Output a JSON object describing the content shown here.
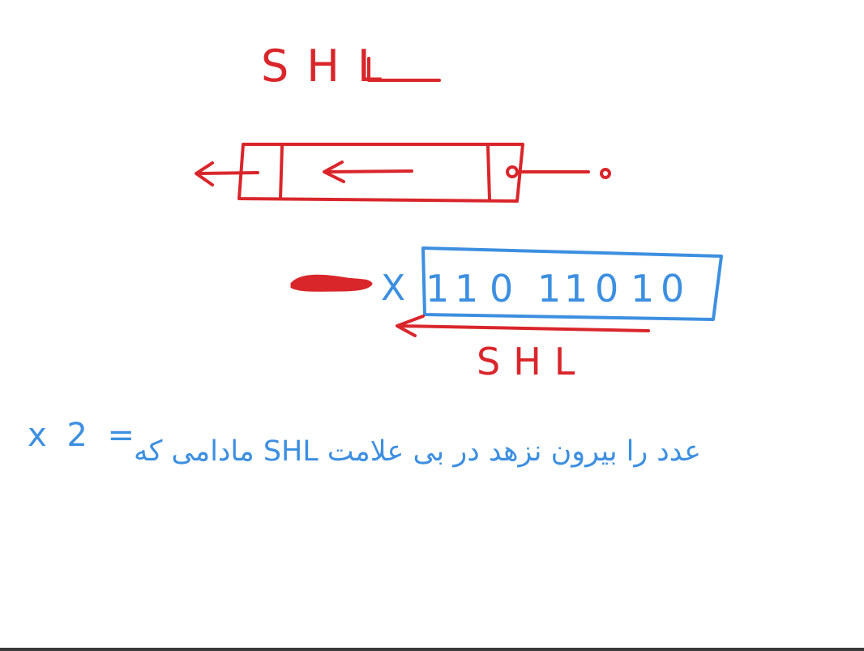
{
  "title": "SHL",
  "register": {
    "bits": [
      "1",
      "1",
      "0",
      "1",
      "1",
      "0",
      "1",
      "0"
    ],
    "discarded_marker": "X",
    "operation_label": "SHL"
  },
  "note": {
    "expression": "x 2 =",
    "persian_text": "مادامی که SHL عدد را بیرون نزهد در بی علامت"
  },
  "colors": {
    "red": "#d9262b",
    "blue": "#3d8fe0"
  }
}
